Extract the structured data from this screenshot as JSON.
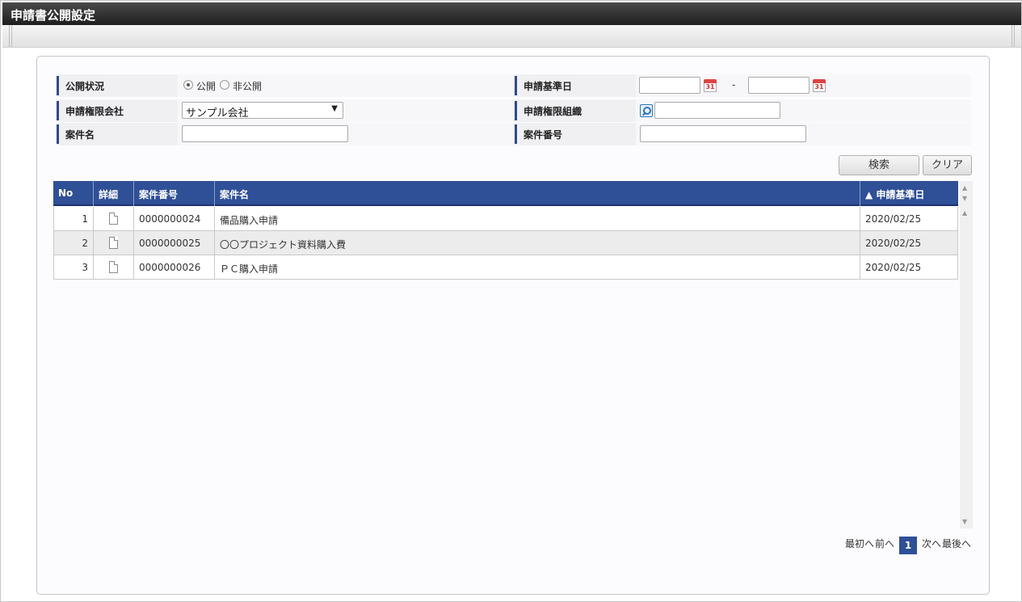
{
  "window": {
    "title": "申請書公開設定"
  },
  "search": {
    "status_label": "公開状況",
    "status_options": [
      {
        "label": "公開",
        "checked": true
      },
      {
        "label": "非公開",
        "checked": false
      }
    ],
    "date_label": "申請基準日",
    "date_from": "",
    "date_separator": "-",
    "date_to": "",
    "calendar_text": "31",
    "company_label": "申請権限会社",
    "company_value": "サンプル会社",
    "org_label": "申請権限組織",
    "org_value": "",
    "matter_name_label": "案件名",
    "matter_name_value": "",
    "matter_no_label": "案件番号",
    "matter_no_value": "",
    "search_button": "検索",
    "clear_button": "クリア"
  },
  "grid": {
    "columns": {
      "no": "No",
      "detail": "詳細",
      "matter_no": "案件番号",
      "matter_name": "案件名",
      "date": "▲ 申請基準日"
    },
    "rows": [
      {
        "no": "1",
        "matter_no": "0000000024",
        "matter_name": "備品購入申請",
        "date": "2020/02/25"
      },
      {
        "no": "2",
        "matter_no": "0000000025",
        "matter_name": "〇〇プロジェクト資料購入費",
        "date": "2020/02/25"
      },
      {
        "no": "3",
        "matter_no": "0000000026",
        "matter_name": "ＰＣ購入申請",
        "date": "2020/02/25"
      }
    ]
  },
  "pager": {
    "first": "最初へ",
    "prev": "前へ",
    "current": "1",
    "next": "次へ",
    "last": "最後へ"
  },
  "colors": {
    "header_blue": "#2f4f97",
    "title_bar": "#2a2a2a"
  }
}
